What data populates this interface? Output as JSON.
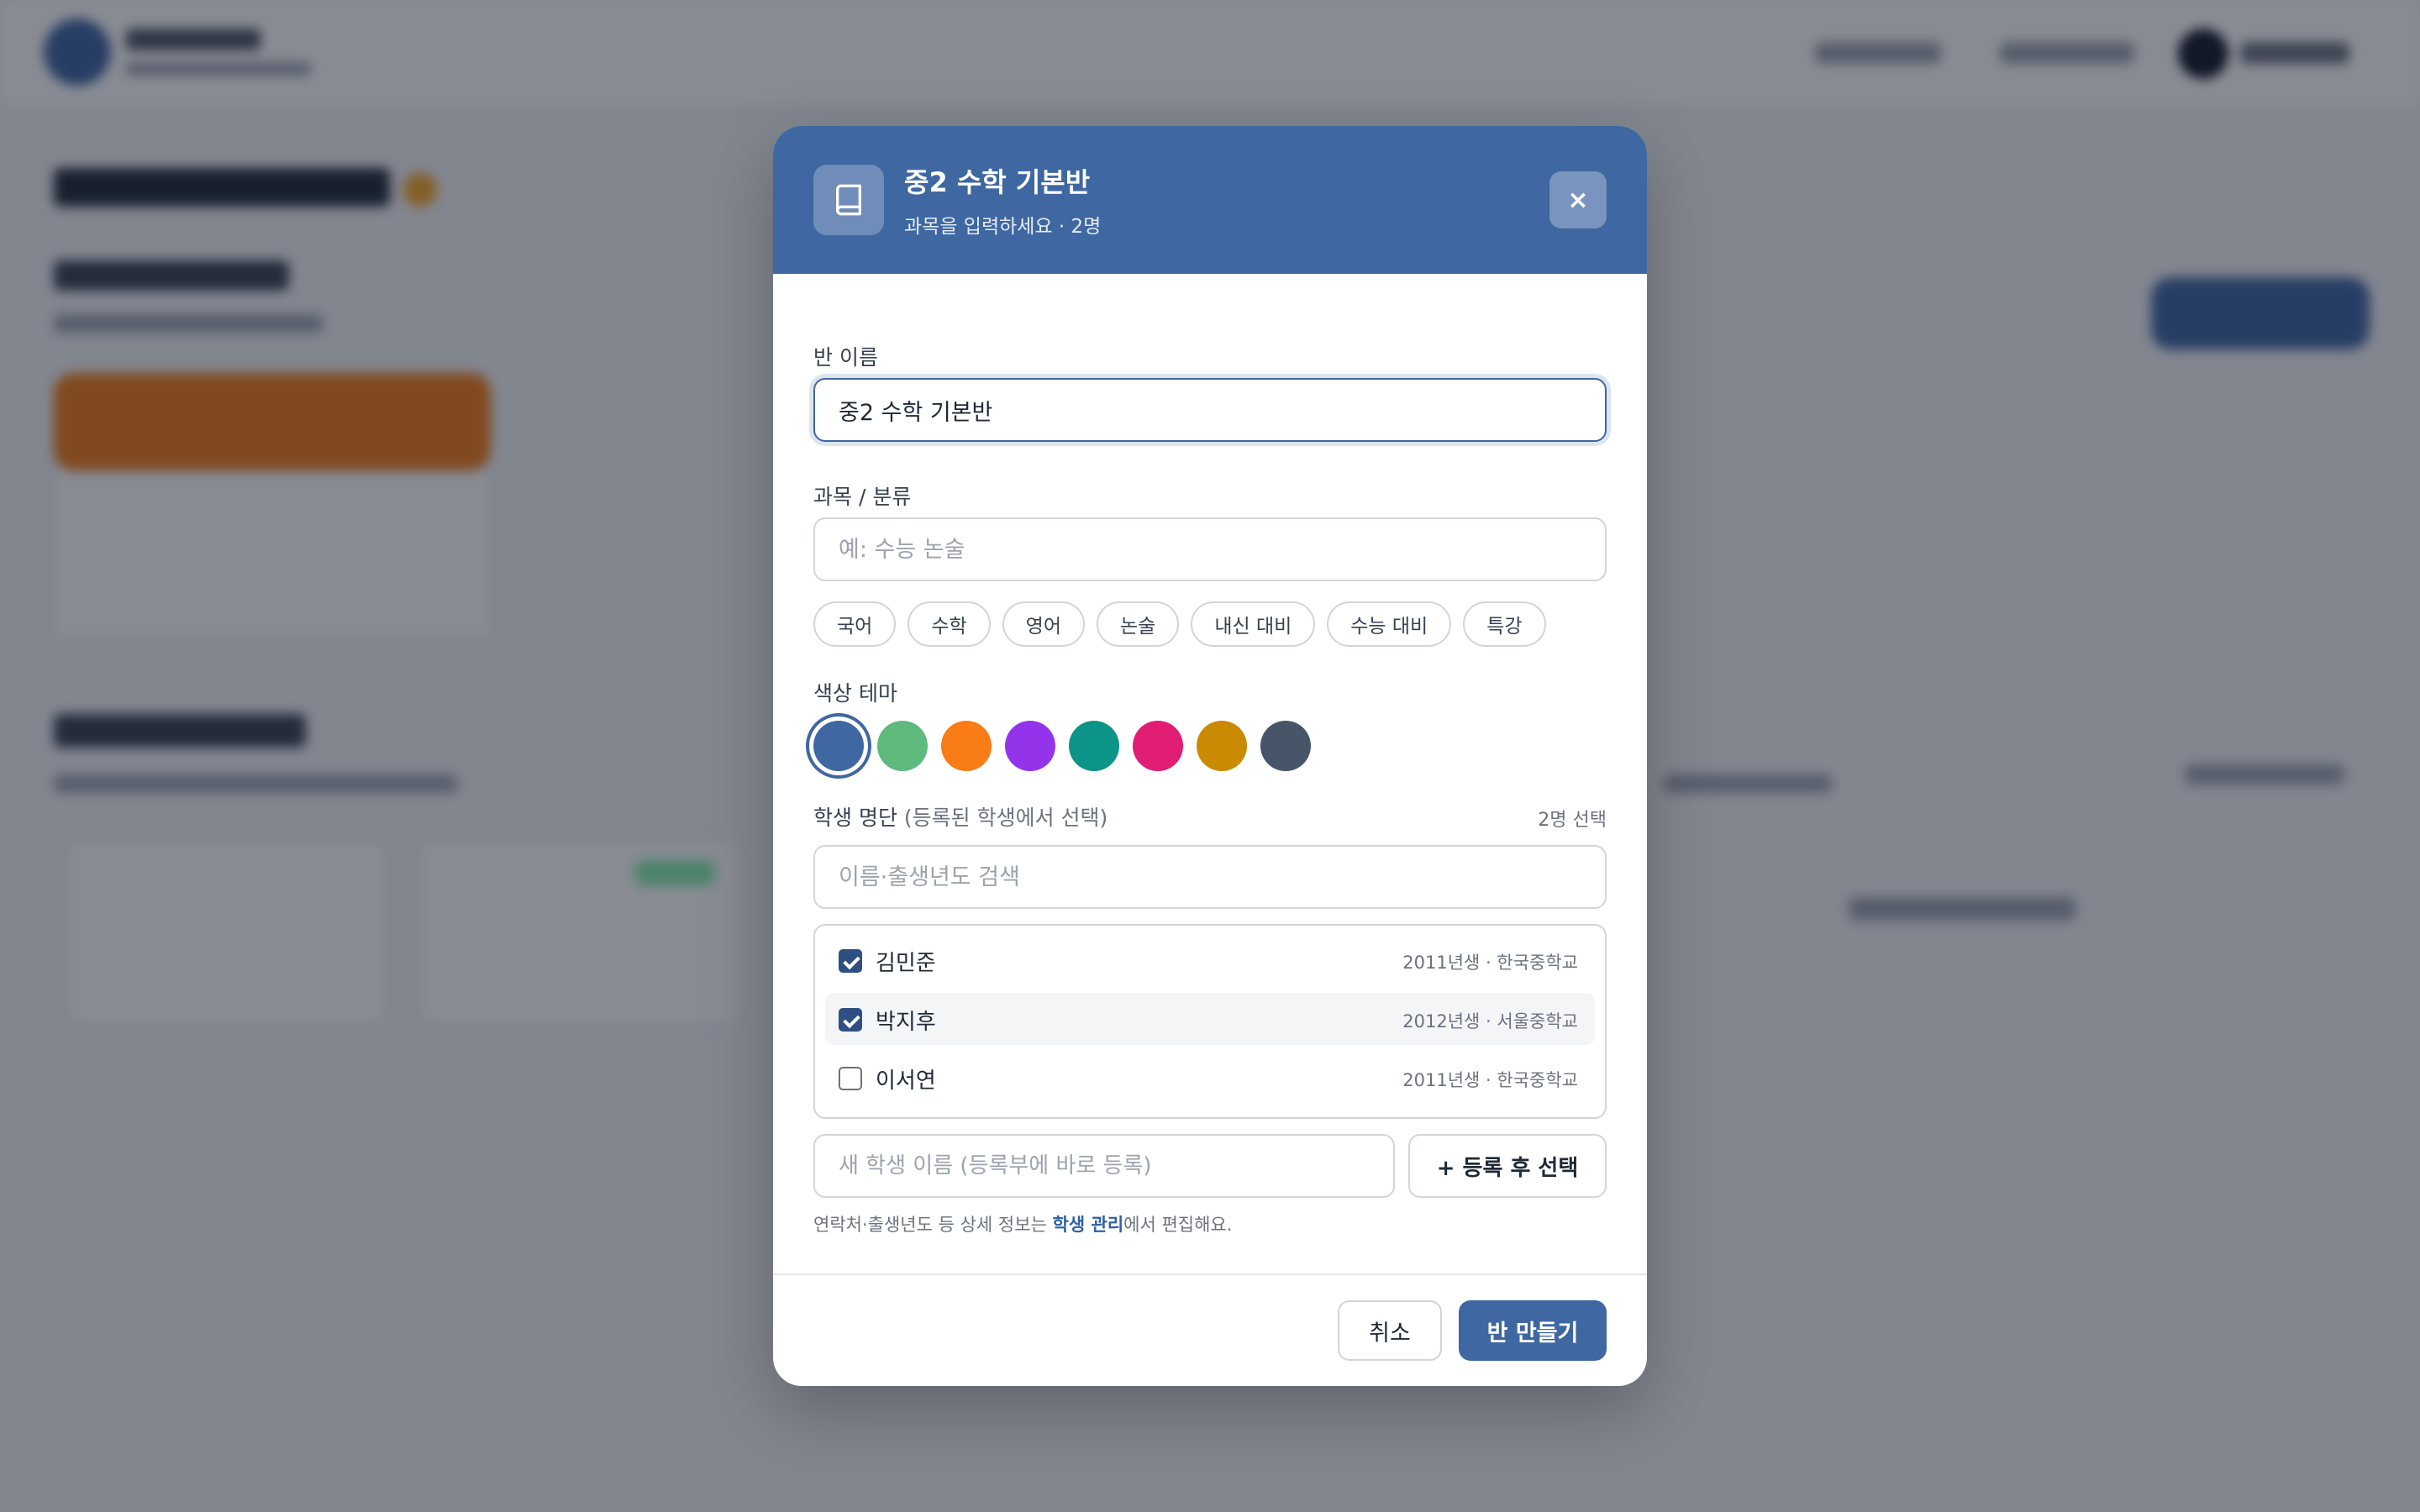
{
  "modal": {
    "title": "중2 수학 기본반",
    "subtitle": "과목을 입력하세요 · 2명",
    "close_label": "×",
    "class_name_label": "반 이름",
    "class_name_value": "중2 수학 기본반",
    "subject_label": "과목 / 분류",
    "subject_placeholder": "예: 수능 논술",
    "subject_chips": [
      "국어",
      "수학",
      "영어",
      "논술",
      "내신 대비",
      "수능 대비",
      "특강"
    ],
    "color_label": "색상 테마",
    "colors": [
      "#3f67a1",
      "#5fba7d",
      "#f97c16",
      "#9333ea",
      "#0d9488",
      "#e11d74",
      "#ca8a04",
      "#475569"
    ],
    "selected_color": "#3f67a1",
    "roster_label": "학생 명단",
    "roster_note": "(등록된 학생에서 선택)",
    "selected_count": "2명 선택",
    "search_placeholder": "이름·출생년도 검색",
    "students": [
      {
        "name": "김민준",
        "meta": "2011년생 · 한국중학교",
        "checked": true
      },
      {
        "name": "박지후",
        "meta": "2012년생 · 서울중학교",
        "checked": true
      },
      {
        "name": "이서연",
        "meta": "2011년생 · 한국중학교",
        "checked": false
      }
    ],
    "new_student_placeholder": "새 학생 이름 (등록부에 바로 등록)",
    "register_button": "+ 등록 후 선택",
    "hint_prefix": "연락처·출생년도 등 상세 정보는 ",
    "hint_link": "학생 관리",
    "hint_suffix": "에서 편집해요.",
    "cancel_button": "취소",
    "create_button": "반 만들기"
  }
}
